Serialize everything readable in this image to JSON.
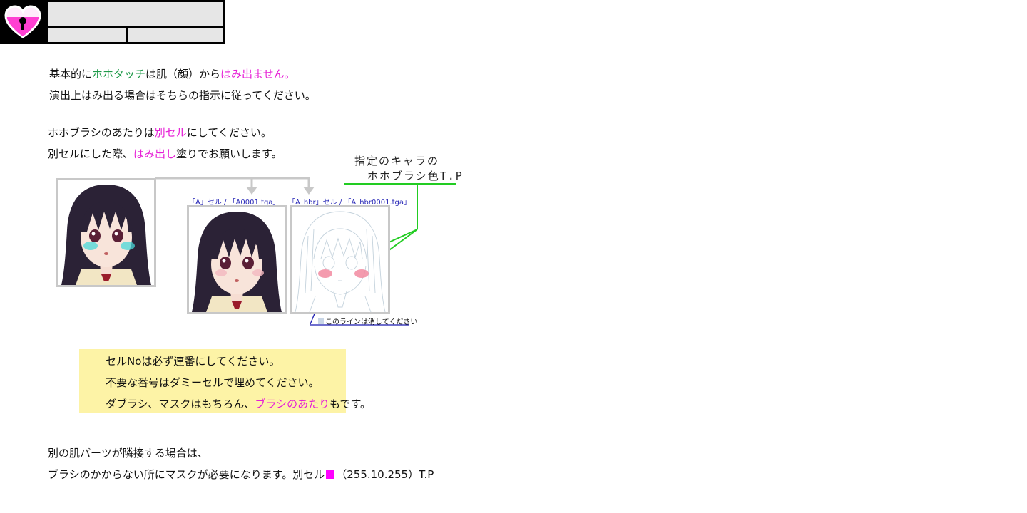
{
  "colors": {
    "accent_green": "#1f9a4a",
    "accent_pink": "#e61ed6",
    "mask_swatch": "#ff00ff",
    "note_bg": "#fdf3a6"
  },
  "header": {
    "logo_icon": "heart-keyhole-icon"
  },
  "section1": {
    "l1_a": "基本的に",
    "l1_b": "ホホタッチ",
    "l1_c": "は肌（顔）から",
    "l1_d": "はみ出ません。",
    "l2": "演出上はみ出る場合はそちらの指示に従ってください。"
  },
  "section2": {
    "l1_a": "ホホブラシのあたりは",
    "l1_b": "別セル",
    "l1_c": "にしてください。",
    "l2_a": "別セルにした際、",
    "l2_b": "はみ出し",
    "l2_c": "塗りでお願いします。"
  },
  "annotation": {
    "line1": "指定のキャラの",
    "line2": "ホホブラシ色T.P"
  },
  "captions": {
    "cel_a": "「A」セル / 「A0001.tga」",
    "cel_hbr": "「A_hbr」セル / 「A_hbr0001.tga」",
    "erase_line": "このラインは消してください"
  },
  "note": {
    "l1": "セルNoは必ず連番にしてください。",
    "l2": "不要な番号はダミーセルで埋めてください。",
    "l3_a": "ダブラシ、マスクはもちろん、",
    "l3_b": "ブラシのあたり",
    "l3_c": "もです。"
  },
  "section3": {
    "l1": "別の肌パーツが隣接する場合は、",
    "l2_a": "ブラシのかからない所にマスクが必要になります。別セル",
    "l2_b": "（255.10.255）T.P"
  }
}
